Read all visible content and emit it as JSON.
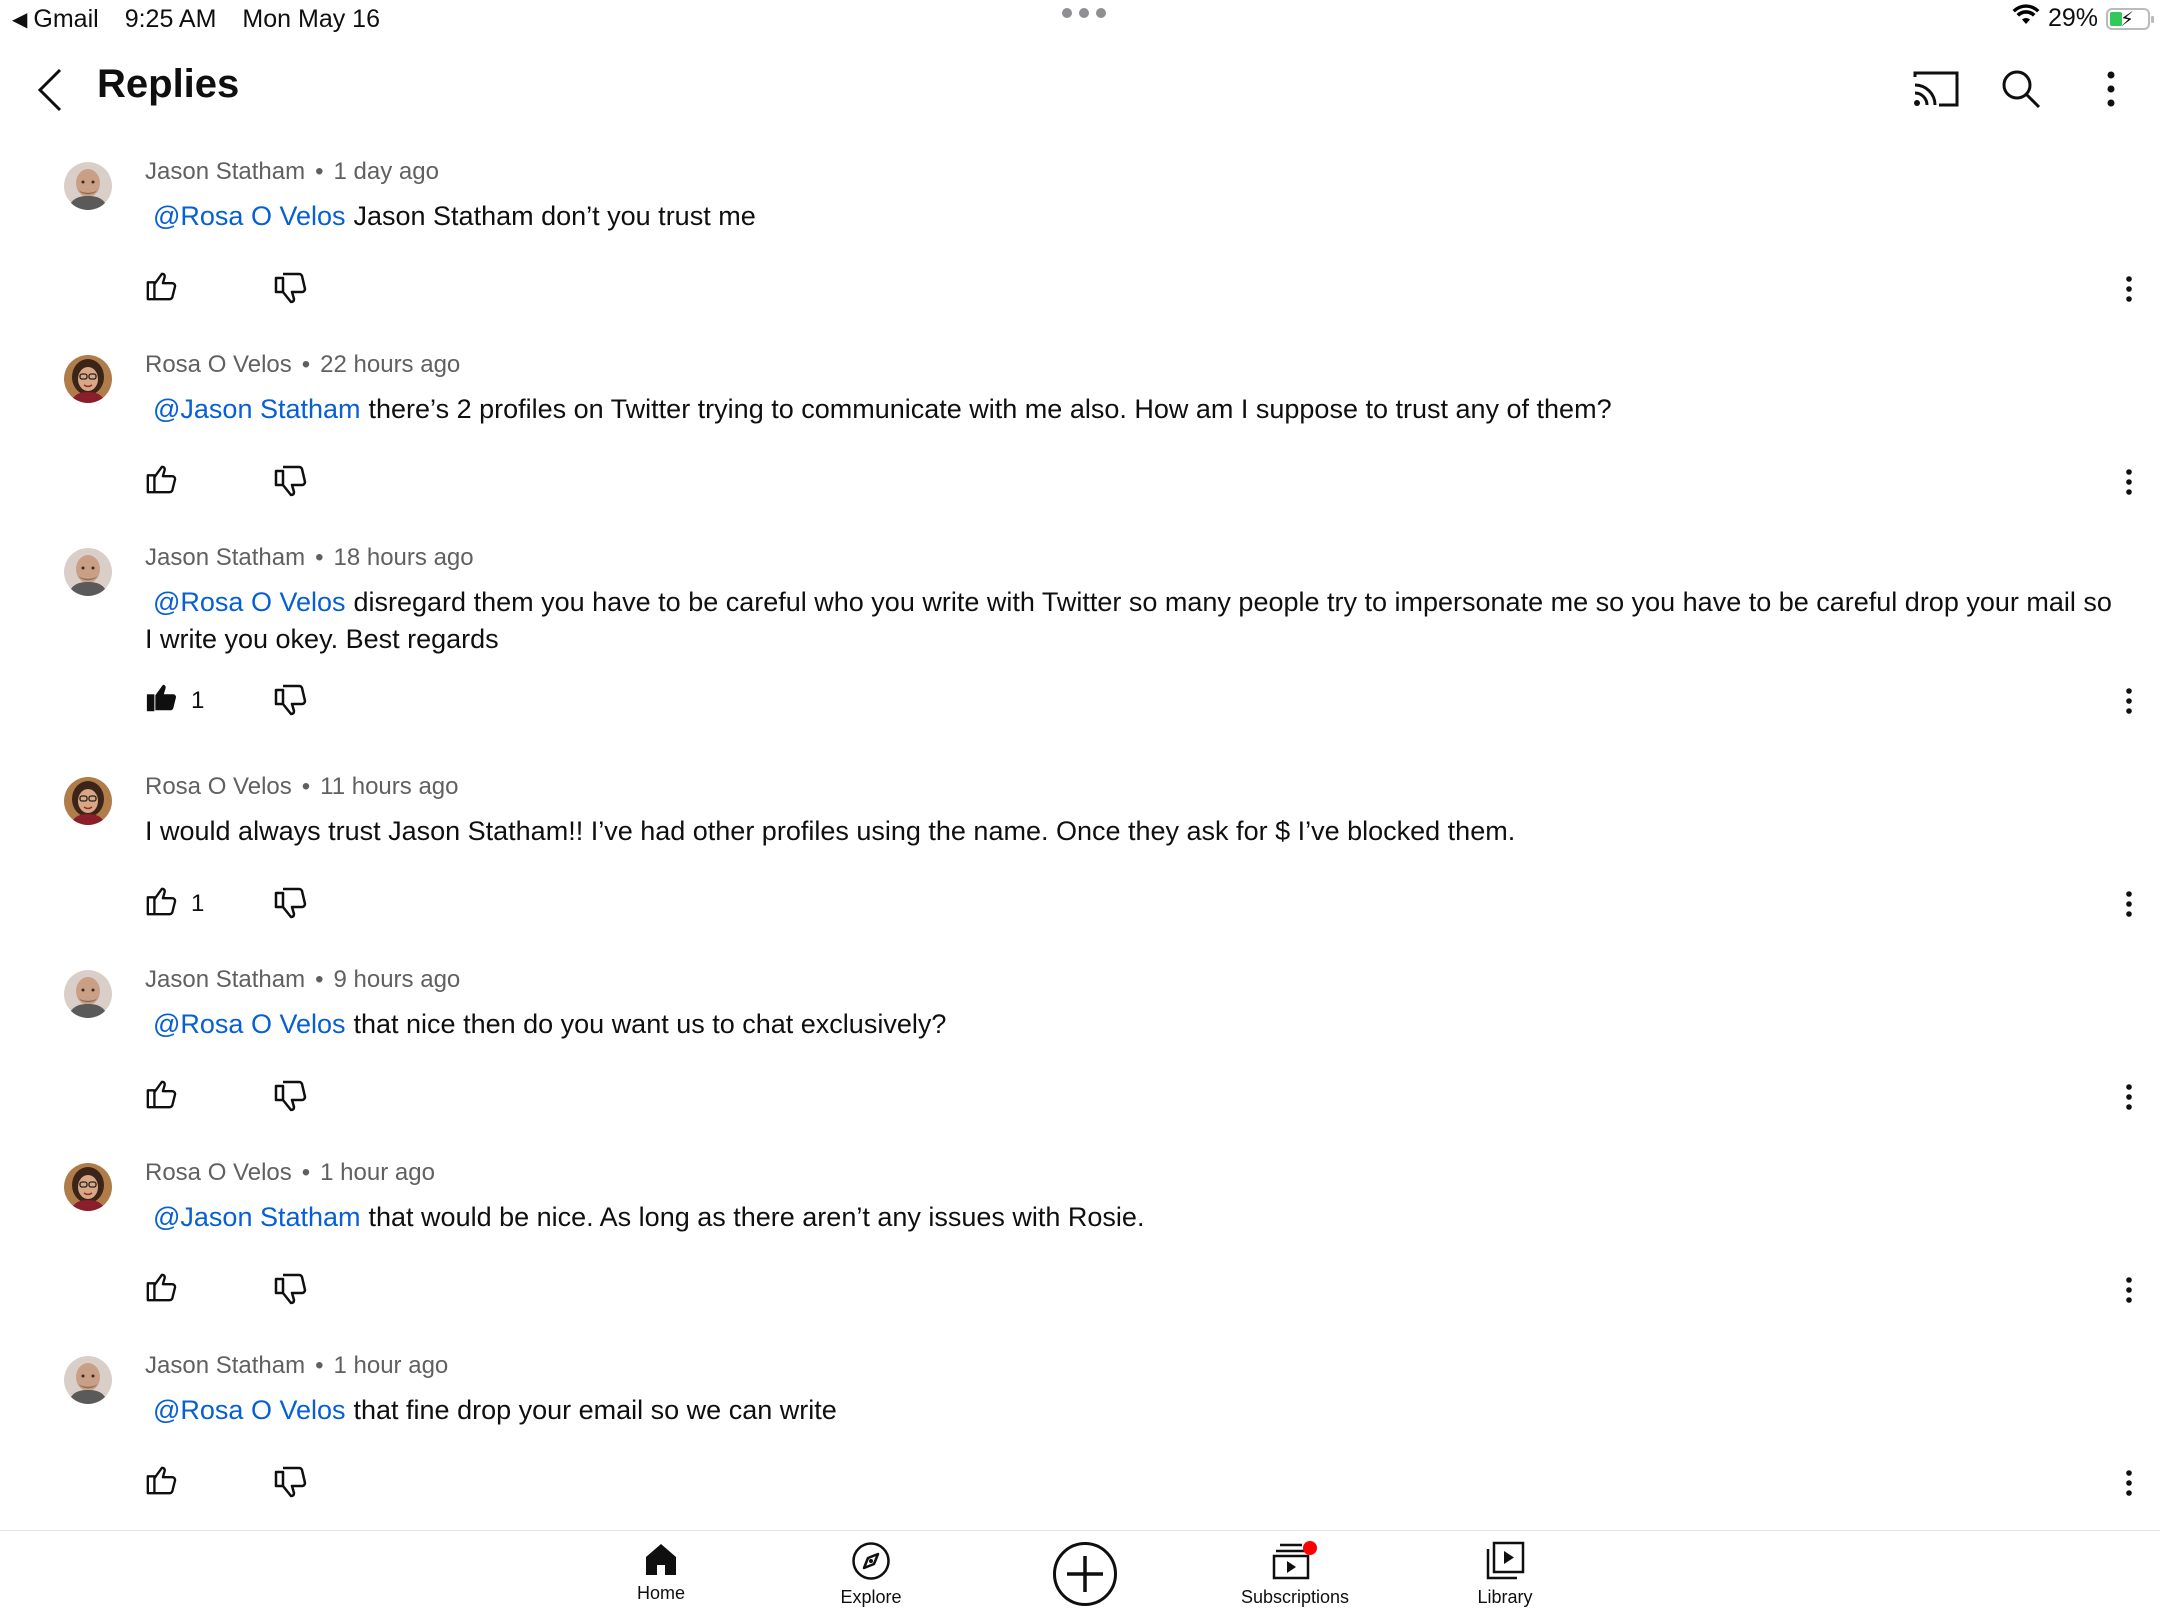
{
  "status_bar": {
    "back_app": "Gmail",
    "time": "9:25 AM",
    "date": "Mon May 16",
    "battery": "29%",
    "battery_level": 0.29,
    "icons": [
      "back-triangle-icon",
      "multitask-dots-icon",
      "wifi-icon",
      "battery-charging-icon"
    ]
  },
  "header": {
    "title": "Replies",
    "icons": [
      "back-icon",
      "cast-icon",
      "search-icon",
      "more-vert-icon"
    ]
  },
  "comments": [
    {
      "author": "Jason Statham",
      "time": "1 day ago",
      "mention": "@Rosa O Velos",
      "text": "Jason Statham  don’t you trust me",
      "likes": "",
      "liked": false,
      "avatar": "man"
    },
    {
      "author": "Rosa O Velos",
      "time": "22 hours ago",
      "mention": "@Jason Statham",
      "text": "there’s 2 profiles on Twitter trying to communicate with me also. How am I suppose to trust any of them?",
      "likes": "",
      "liked": false,
      "avatar": "woman"
    },
    {
      "author": "Jason Statham",
      "time": "18 hours ago",
      "mention": "@Rosa O Velos",
      "text": "disregard them you have to be careful who you write with Twitter so many people try to impersonate me so you have to be careful drop your mail so I write you okey. Best regards",
      "likes": "1",
      "liked": true,
      "avatar": "man"
    },
    {
      "author": "Rosa O Velos",
      "time": "11 hours ago",
      "mention": "",
      "text": "I would always trust Jason Statham!! I’ve had other profiles using the name. Once they ask for $ I’ve blocked them.",
      "likes": "1",
      "liked": false,
      "avatar": "woman"
    },
    {
      "author": "Jason Statham",
      "time": "9 hours ago",
      "mention": "@Rosa O Velos",
      "text": "that nice then do you want us to chat exclusively?",
      "likes": "",
      "liked": false,
      "avatar": "man"
    },
    {
      "author": "Rosa O Velos",
      "time": "1 hour ago",
      "mention": "@Jason Statham",
      "text": "that would be nice. As long as there aren’t any issues with Rosie.",
      "likes": "",
      "liked": false,
      "avatar": "woman"
    },
    {
      "author": "Jason Statham",
      "time": "1 hour ago",
      "mention": "@Rosa O Velos",
      "text": "that fine drop your email so we can write",
      "likes": "",
      "liked": false,
      "avatar": "man"
    }
  ],
  "bottom_nav": {
    "items": [
      {
        "label": "Home",
        "icon": "home-icon"
      },
      {
        "label": "Explore",
        "icon": "explore-icon"
      },
      {
        "label": "",
        "icon": "create-plus-icon"
      },
      {
        "label": "Subscriptions",
        "icon": "subscriptions-icon",
        "badge": true
      },
      {
        "label": "Library",
        "icon": "library-icon"
      }
    ]
  },
  "colors": {
    "mention": "#065fd4",
    "meta": "#606060",
    "text": "#0f0f0f",
    "badge": "#ff0000",
    "battery": "#34c759"
  }
}
